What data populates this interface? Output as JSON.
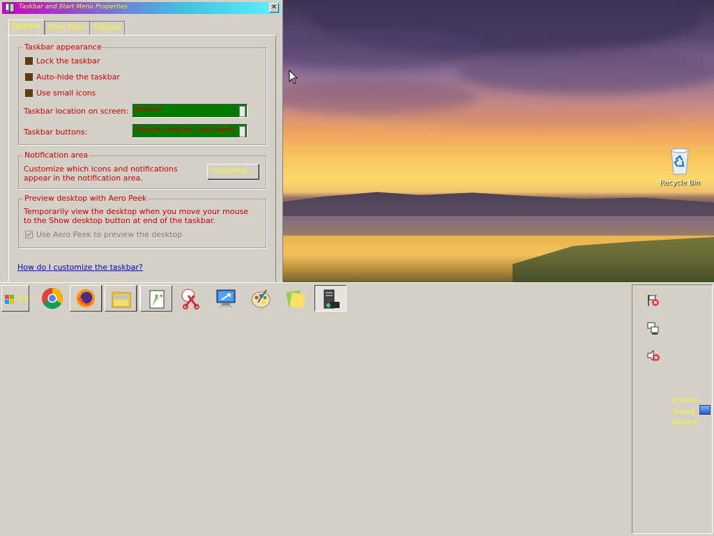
{
  "dialog": {
    "title": "Taskbar and Start Menu Properties",
    "close_glyph": "✕",
    "tabs": [
      {
        "label": "Taskbar",
        "active": true
      },
      {
        "label": "Start Menu",
        "active": false
      },
      {
        "label": "Toolbars",
        "active": false
      }
    ],
    "appearance": {
      "group_title": "Taskbar appearance",
      "lock_label": "Lock the taskbar",
      "autohide_label": "Auto-hide the taskbar",
      "small_icons_label": "Use small icons",
      "location_label": "Taskbar location on screen:",
      "location_value": "Bottom",
      "buttons_label": "Taskbar buttons:",
      "buttons_value": "Always combine, hide labels"
    },
    "notification": {
      "group_title": "Notification area",
      "text": "Customize which icons and notifications appear in the notification area.",
      "customize_label": "Customize..."
    },
    "peek": {
      "group_title": "Preview desktop with Aero Peek",
      "text": "Temporarily view the desktop when you move your mouse to the Show desktop button at end of the taskbar.",
      "checkbox_label": "Use Aero Peek to preview the desktop"
    },
    "help_link": "How do I customize the taskbar?"
  },
  "desktop": {
    "recycle_bin_label": "Recycle Bin"
  },
  "taskbar": {
    "start_label": "Sta",
    "apps": [
      "chrome-icon",
      "firefox-icon",
      "file-explorer-icon",
      "notepad-plus-plus-icon",
      "snipping-tool-icon",
      "remote-desktop-icon",
      "paint-icon",
      "sticky-notes-icon",
      "server-manager-icon"
    ]
  },
  "tray": {
    "overflow_glyph": "^",
    "clock_time": "10:33 AM",
    "clock_day": "Tuesday",
    "clock_date": "3/6/2018"
  },
  "colors": {
    "dialog_text": "#cc0000",
    "highlight_text": "#ffff00",
    "combo_bg": "#007a00",
    "face": "#d4d0c8"
  }
}
